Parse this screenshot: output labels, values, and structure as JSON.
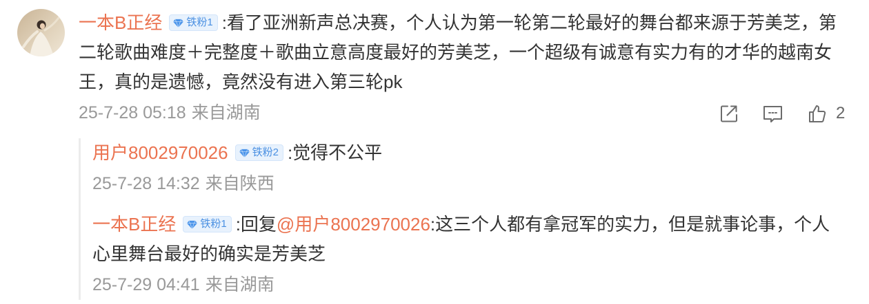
{
  "comment": {
    "username": "一本B正经",
    "badge": {
      "label": "铁粉1"
    },
    "text": ":看了亚洲新声总决赛，个人认为第一轮第二轮最好的舞台都来源于芳美芝，第二轮歌曲难度＋完整度＋歌曲立意高度最好的芳美芝，一个超级有诚意有实力有的才华的越南女王，真的是遗憾，竟然没有进入第三轮pk",
    "time": "25-7-28 05:18",
    "location": "来自湖南",
    "actions": {
      "like_count": "2"
    }
  },
  "replies": [
    {
      "username": "用户8002970026",
      "badge": {
        "label": "铁粉2"
      },
      "text": ":觉得不公平",
      "time": "25-7-28 14:32",
      "location": "来自陕西"
    },
    {
      "username": "一本B正经",
      "badge": {
        "label": "铁粉1"
      },
      "reply_prefix": ":回复",
      "mention": "@用户8002970026",
      "text": ":这三个人都有拿冠军的实力，但是就事论事，个人心里舞台最好的确实是芳美芝",
      "time": "25-7-29 04:41",
      "location": "来自湖南"
    }
  ],
  "icons": {
    "avatar": "user-avatar-photo",
    "badge": "diamond-icon",
    "share": "share-icon",
    "comment": "comment-icon",
    "like": "thumbs-up-icon"
  },
  "colors": {
    "username": "#eb7350",
    "text": "#333333",
    "meta": "#999999",
    "badge_bg": "#e8f2fd",
    "badge_text": "#4a90e2",
    "icon": "#6b6b6b",
    "thread_line": "#ececec"
  }
}
